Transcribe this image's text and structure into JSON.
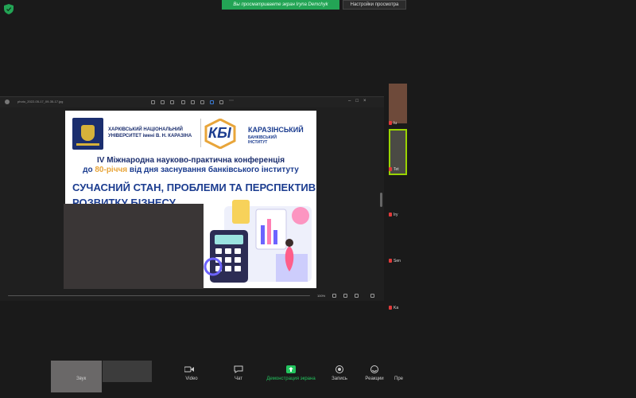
{
  "top_bar": {
    "banner_text": "Вы просматриваете экран Iryna Demchyk",
    "view_options_label": "Настройки просмотра"
  },
  "shared_window": {
    "title": "photo_2022-05-17_09-35-17.jpg",
    "zoom_level": "100%"
  },
  "slide": {
    "university_name_line1": "ХАРКІВСЬКИЙ НАЦІОНАЛЬНИЙ",
    "university_name_line2": "УНІВЕРСИТЕТ імені В. Н. КАРАЗІНА",
    "kbi_mark": "КБІ",
    "institute_name_line1": "КАРАЗІНСЬКИЙ",
    "institute_name_line2": "БАНКІВСЬКИЙ",
    "institute_name_line3": "ІНСТИТУТ",
    "conference_line1": "IV Міжнародна науково-практична конференція",
    "conference_line2_pre": "до ",
    "conference_line2_highlight": "80-річчя",
    "conference_line2_post": " від дня заснування банківського інституту",
    "theme_line1": "СУЧАСНИЙ СТАН, ПРОБЛЕМИ ТА ПЕРСПЕКТИВИ",
    "theme_line2": "РОЗВИТКУ БІЗНЕСУ"
  },
  "participants": [
    {
      "label": "Iu"
    },
    {
      "label": "Tet"
    },
    {
      "label": "Iry"
    },
    {
      "label": "Sen"
    },
    {
      "label": "Ka"
    }
  ],
  "toolbar": {
    "audio_label": "Звук",
    "video_label": "Video",
    "chat_label": "Чат",
    "share_label": "Демонстрация экрана",
    "record_label": "Запись",
    "reactions_label": "Реакции",
    "more_label": "Пре"
  },
  "colors": {
    "accent_green": "#23a455",
    "slide_blue": "#1b3c8f",
    "highlight_orange": "#e8a53a",
    "muted_red": "#e03a3a"
  }
}
